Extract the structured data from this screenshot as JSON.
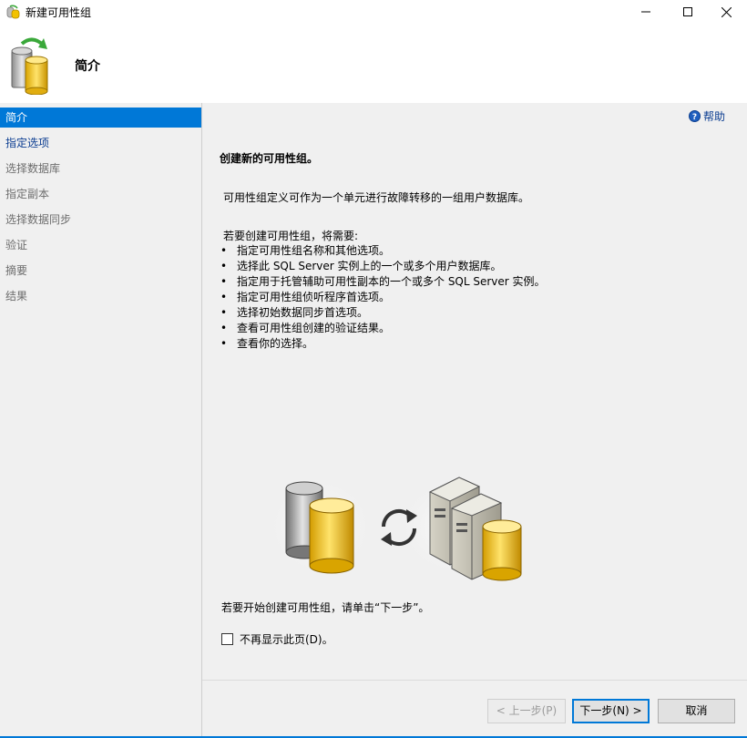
{
  "window": {
    "title": "新建可用性组"
  },
  "header": {
    "heading": "简介"
  },
  "sidebar": {
    "items": [
      {
        "label": "简介",
        "state": "active"
      },
      {
        "label": "指定选项",
        "state": "enabled"
      },
      {
        "label": "选择数据库",
        "state": "disabled"
      },
      {
        "label": "指定副本",
        "state": "disabled"
      },
      {
        "label": "选择数据同步",
        "state": "disabled"
      },
      {
        "label": "验证",
        "state": "disabled"
      },
      {
        "label": "摘要",
        "state": "disabled"
      },
      {
        "label": "结果",
        "state": "disabled"
      }
    ]
  },
  "content": {
    "help_label": "帮助",
    "heading": "创建新的可用性组。",
    "description": "可用性组定义可作为一个单元进行故障转移的一组用户数据库。",
    "requirements_intro": "若要创建可用性组，将需要:",
    "bullets": [
      "指定可用性组名称和其他选项。",
      "选择此 SQL Server 实例上的一个或多个用户数据库。",
      "指定用于托管辅助可用性副本的一个或多个 SQL Server 实例。",
      "指定可用性组侦听程序首选项。",
      "选择初始数据同步首选项。",
      "查看可用性组创建的验证结果。",
      "查看你的选择。"
    ],
    "start_text": "若要开始创建可用性组，请单击“下一步”。",
    "checkbox_label": "不再显示此页(D)。",
    "checkbox_checked": false
  },
  "footer": {
    "prev_label": "< 上一步(P)",
    "next_label": "下一步(N) >",
    "cancel_label": "取消"
  },
  "colors": {
    "accent": "#0078d7",
    "panel": "#f0f0f0",
    "link": "#0b3d91"
  }
}
